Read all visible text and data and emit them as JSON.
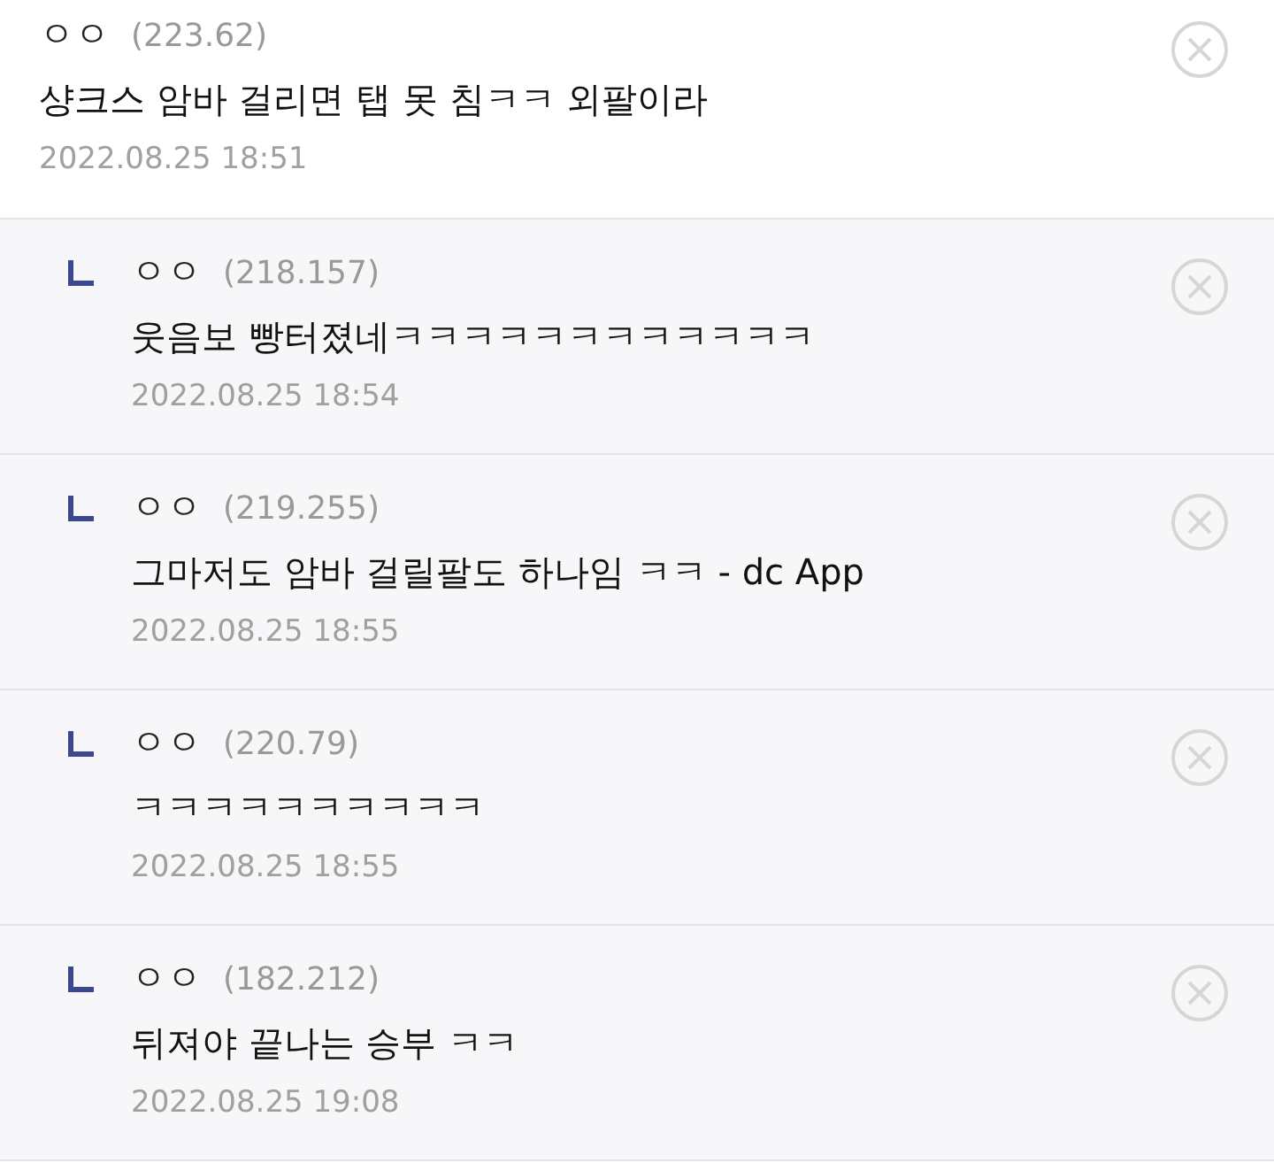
{
  "comments": [
    {
      "kind": "comment",
      "name": "ㅇㅇ",
      "ip": "(223.62)",
      "text": "샹크스 암바 걸리면 탭 못 침ㅋㅋ 외팔이라",
      "date": "2022.08.25 18:51"
    },
    {
      "kind": "reply",
      "name": "ㅇㅇ",
      "ip": "(218.157)",
      "text": "웃음보 빵터졌네ㅋㅋㅋㅋㅋㅋㅋㅋㅋㅋㅋㅋ",
      "date": "2022.08.25 18:54"
    },
    {
      "kind": "reply",
      "name": "ㅇㅇ",
      "ip": "(219.255)",
      "text": "그마저도 암바 걸릴팔도 하나임 ㅋㅋ - dc App",
      "date": "2022.08.25 18:55"
    },
    {
      "kind": "reply",
      "name": "ㅇㅇ",
      "ip": "(220.79)",
      "text": "ㅋㅋㅋㅋㅋㅋㅋㅋㅋㅋ",
      "date": "2022.08.25 18:55"
    },
    {
      "kind": "reply",
      "name": "ㅇㅇ",
      "ip": "(182.212)",
      "text": "뒤져야 끝나는 승부 ㅋㅋ",
      "date": "2022.08.25 19:08"
    }
  ]
}
